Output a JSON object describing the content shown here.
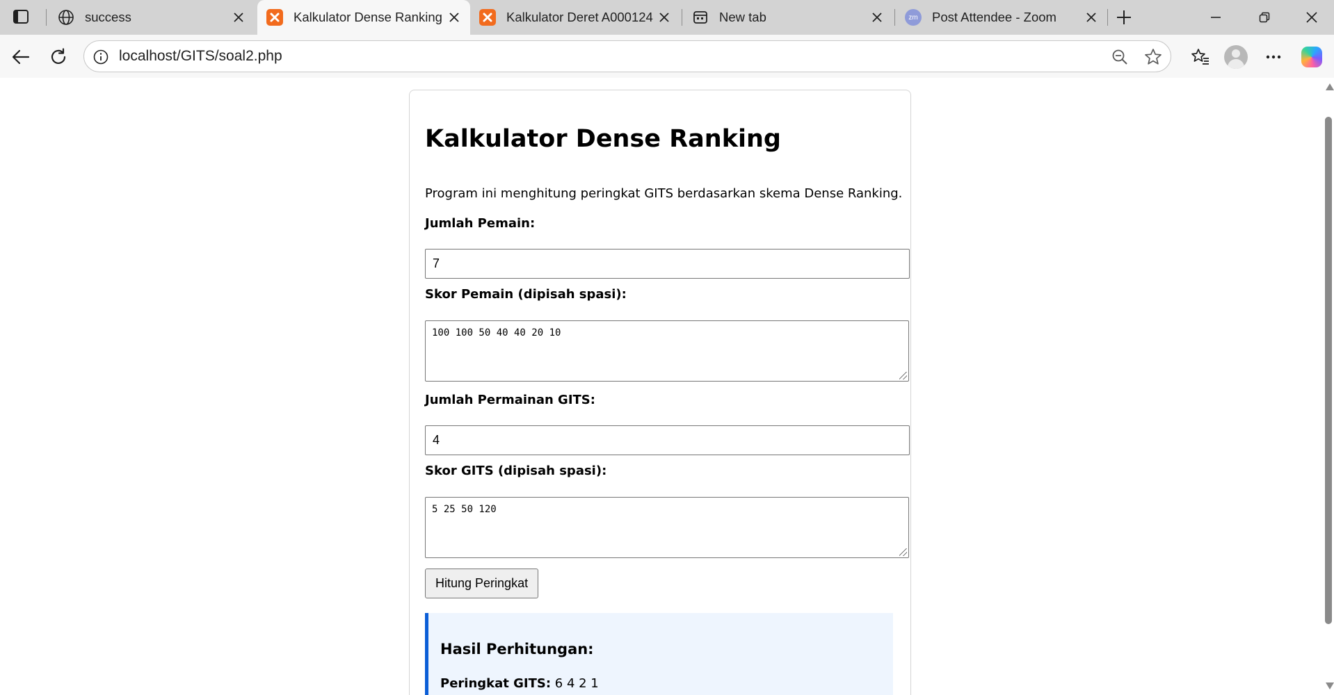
{
  "tabs": [
    {
      "title": "success",
      "favicon": "globe-icon",
      "active": false
    },
    {
      "title": "Kalkulator Dense Ranking",
      "favicon": "xampp-icon",
      "active": true
    },
    {
      "title": "Kalkulator Deret A000124",
      "favicon": "xampp-icon",
      "active": false
    },
    {
      "title": "New tab",
      "favicon": "newtab-icon",
      "active": false
    },
    {
      "title": "Post Attendee - Zoom",
      "favicon": "zoom-icon",
      "active": false,
      "favicon_text": "zm"
    }
  ],
  "address_bar": {
    "url": "localhost/GITS/soal2.php"
  },
  "page": {
    "title": "Kalkulator Dense Ranking",
    "description": "Program ini menghitung peringkat GITS berdasarkan skema Dense Ranking.",
    "form": {
      "players_count_label": "Jumlah Pemain:",
      "players_count_value": "7",
      "player_scores_label": "Skor Pemain (dipisah spasi):",
      "player_scores_value": "100 100 50 40 40 20 10",
      "games_count_label": "Jumlah Permainan GITS:",
      "games_count_value": "4",
      "gits_scores_label": "Skor GITS (dipisah spasi):",
      "gits_scores_value": "5 25 50 120",
      "submit_label": "Hitung Peringkat"
    },
    "result": {
      "heading": "Hasil Perhitungan:",
      "label": "Peringkat GITS:",
      "value": "6 4 2 1"
    }
  },
  "colors": {
    "tabstrip_bg": "#d3d3d3",
    "toolbar_bg": "#f7f7f7",
    "xampp_orange": "#f26b1d",
    "result_bg": "#eef5fe",
    "result_accent": "#0b5ed7"
  }
}
